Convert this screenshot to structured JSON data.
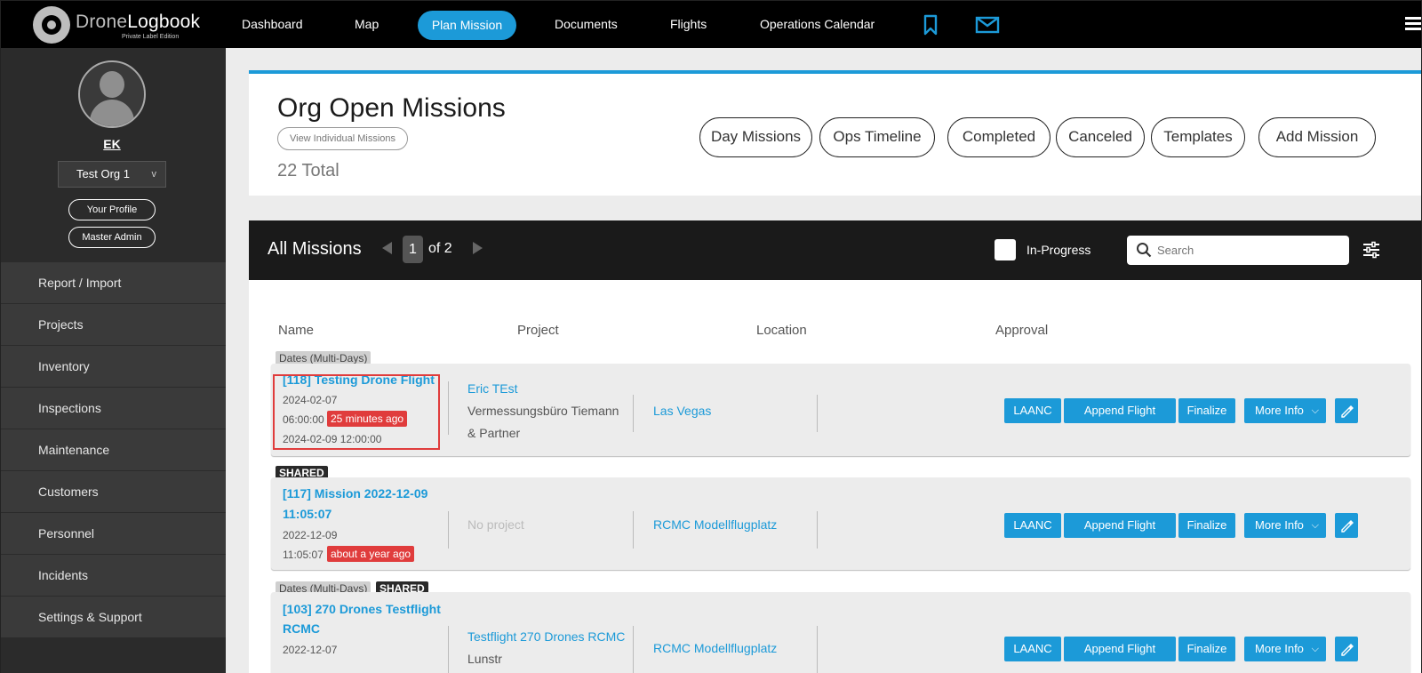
{
  "app": {
    "logo_name_a": "Drone",
    "logo_name_b": "Logbook",
    "logo_sub": "Private Label Edition"
  },
  "nav": {
    "dashboard": "Dashboard",
    "map": "Map",
    "plan_mission": "Plan Mission",
    "documents": "Documents",
    "flights": "Flights",
    "ops_calendar": "Operations Calendar"
  },
  "sidebar": {
    "user": "EK",
    "org": "Test Org 1",
    "org_arrow": "v",
    "your_profile": "Your Profile",
    "master_admin": "Master Admin",
    "items": [
      "Report / Import",
      "Projects",
      "Inventory",
      "Inspections",
      "Maintenance",
      "Customers",
      "Personnel",
      "Incidents",
      "Settings & Support"
    ]
  },
  "header": {
    "title": "Org Open Missions",
    "view_individual": "View Individual Missions",
    "total": "22 Total",
    "buttons": [
      "Day Missions",
      "Ops Timeline",
      "Completed",
      "Canceled",
      "Templates",
      "Add Mission"
    ]
  },
  "list": {
    "title": "All Missions",
    "page": "1",
    "page_of": "of 2",
    "in_progress_label": "In-Progress",
    "search_placeholder": "Search",
    "columns": [
      "Name",
      "Project",
      "Location",
      "Approval"
    ]
  },
  "actions": {
    "laanc": "LAANC",
    "append": "Append Flight",
    "finalize": "Finalize",
    "more": "More Info"
  },
  "missions": [
    {
      "tags": [
        "Dates (Multi-Days)"
      ],
      "name": "[118] Testing Drone Flight",
      "start_date": "2024-02-07",
      "start_time": "06:00:00",
      "ago": "25 minutes ago",
      "end": "2024-02-09 12:00:00",
      "project_link": "Eric TEst",
      "project_lines": [
        "Vermessungsbüro Tiemann",
        "& Partner"
      ],
      "location": "Las Vegas"
    },
    {
      "tags": [
        "SHARED"
      ],
      "name_lines": [
        "[117] Mission 2022-12-09",
        "11:05:07"
      ],
      "start_date": "2022-12-09",
      "start_time": "11:05:07",
      "ago": "about a year ago",
      "project_none": "No project",
      "location": "RCMC Modellflugplatz"
    },
    {
      "tags": [
        "Dates (Multi-Days)",
        "SHARED"
      ],
      "name_lines": [
        "[103] 270 Drones Testflight",
        "RCMC"
      ],
      "start_date": "2022-12-07",
      "project_link": "Testflight 270 Drones RCMC",
      "project_partial": "Lunstr",
      "location": "RCMC Modellflugplatz"
    }
  ],
  "colors": {
    "accent": "#1c9ad8",
    "alert": "#e03c3c",
    "topbar": "#000000",
    "sidebar": "#2b2b2b"
  }
}
